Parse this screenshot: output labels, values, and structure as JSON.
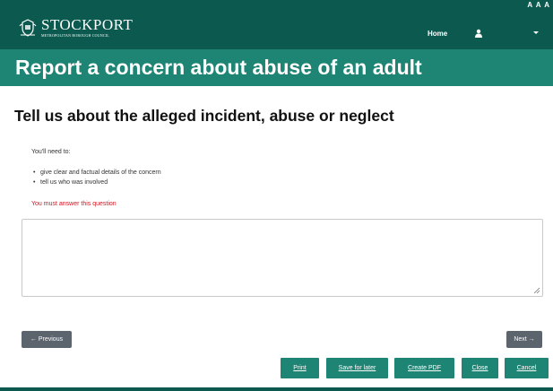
{
  "header": {
    "text_size_controls": [
      "A",
      "A",
      "A"
    ],
    "logo_name": "STOCKPORT",
    "logo_subtitle": "METROPOLITAN BOROUGH COUNCIL",
    "nav_home": "Home",
    "user_icon": "user-icon",
    "menu_icon": "caret-down-icon"
  },
  "banner": {
    "title": "Report a concern about abuse of an adult"
  },
  "question": {
    "title": "Tell us about the alleged incident, abuse or neglect",
    "intro": "You'll need to:",
    "bullets": [
      "give clear and factual details of the concern",
      "tell us who was involved"
    ],
    "error": "You must answer this question",
    "answer_value": ""
  },
  "navigation": {
    "previous_label": "← Previous",
    "next_label": "Next →"
  },
  "actions": {
    "print": "Print",
    "save_for_later": "Save for later",
    "create_pdf": "Create PDF",
    "close": "Close",
    "cancel": "Cancel"
  },
  "colors": {
    "header_bg": "#0c5a4f",
    "banner_bg": "#1e8474",
    "error": "#d4121f",
    "nav_button_bg": "#5c646d"
  }
}
